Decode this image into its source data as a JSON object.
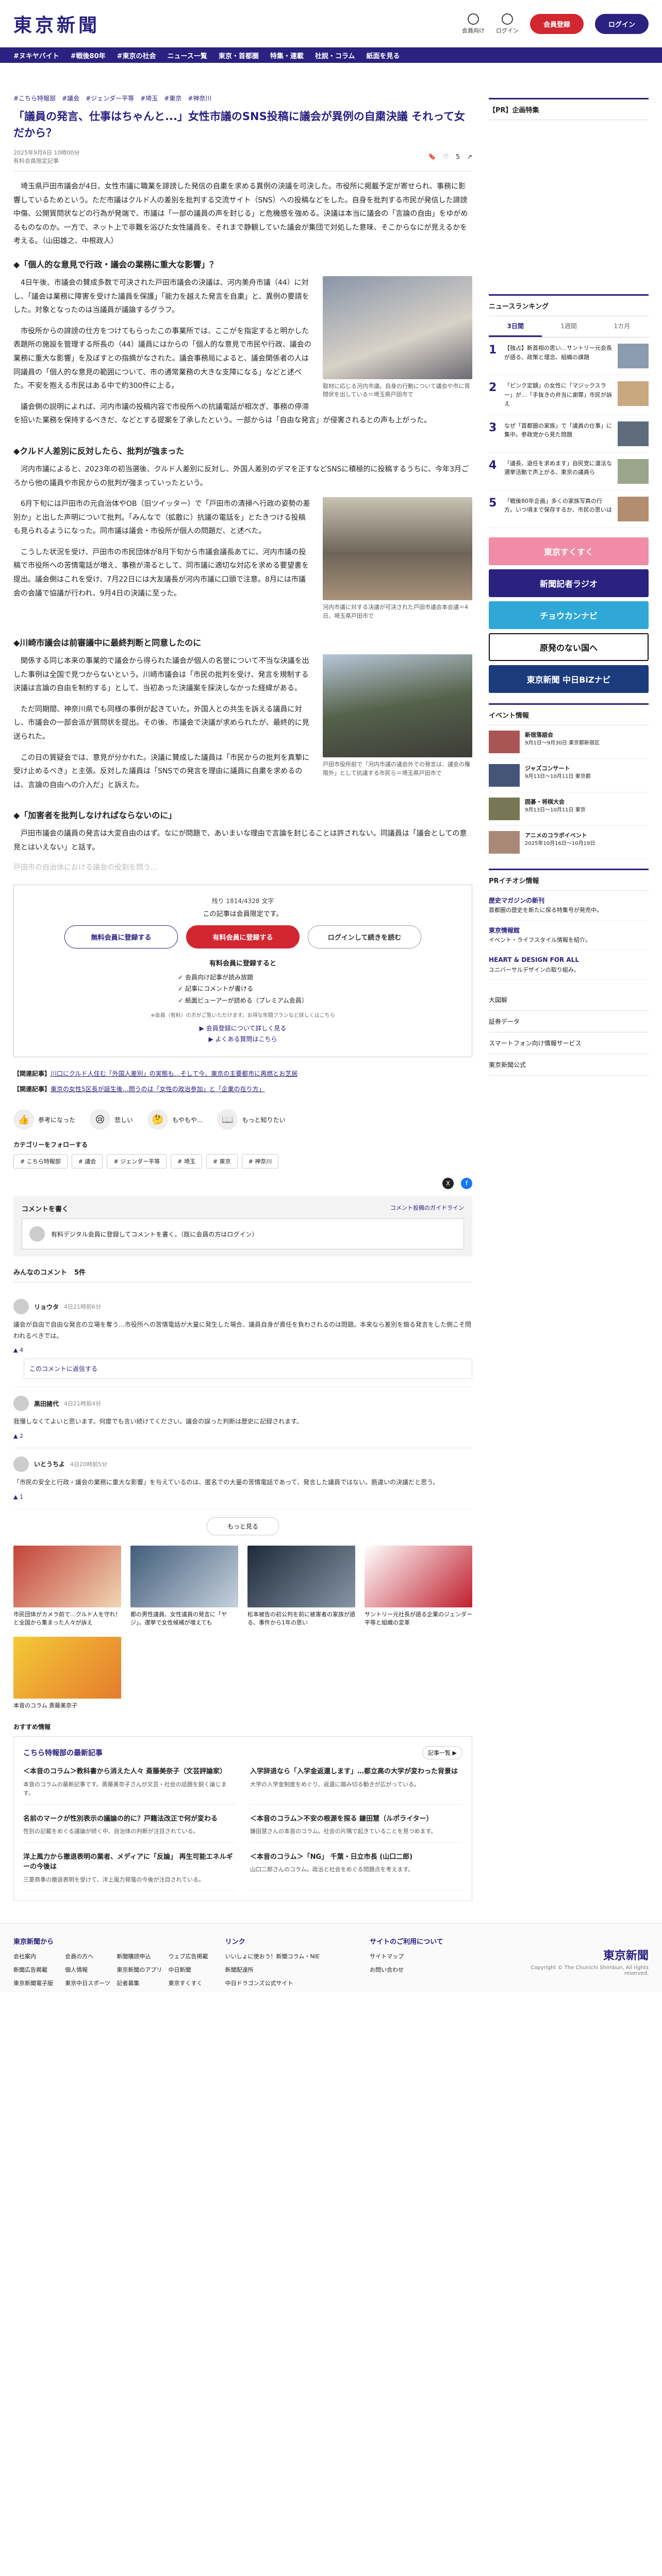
{
  "site": {
    "logo": "東京新聞",
    "header_buttons": [
      "会員向け",
      "ログイン"
    ],
    "register": "会員登録",
    "login": "ログイン"
  },
  "nav": [
    "#ヌキヤバイト",
    "#戦後80年",
    "#東京の社会",
    "ニュース一覧",
    "東京・首都圏",
    "特集・連載",
    "社説・コラム",
    "紙面を見る"
  ],
  "breadcrumb": [
    "#こちら特報部",
    "#議会",
    "#ジェンダー平等",
    "#埼玉",
    "#東京",
    "#神奈川"
  ],
  "article": {
    "title": "「議員の発言、仕事はちゃんと...」女性市議のSNS投稿に議会が異例の自粛決議 それって女だから？",
    "meta": "2025年9月6日 10時00分",
    "meta2": "有料会員限定記事",
    "like_count": "5",
    "lead": "埼玉県戸田市議会が4日、女性市議に職業を誹謗した発信の自粛を求める異例の決議を可決した。市役所に掲載予定が寄せられ、事務に影響しているためという。ただ市議はクルド人の差別を批判する交流サイト（SNS）への投稿などをした。自身を批判する市民が発信した誹謗中傷、公開質問状などの行為が発端で、市議は「一部の議員の声を封じる」と危機感を強める。決議は本当に議会の「言論の自由」をゆがめるものなのか。一方で、ネット上で非難を浴びた女性議員を、それまで静観していた議会が集団で対処した意味、そこからなにが見えるかを考える。（山田雄之、中根政人）",
    "h_first": "◆「個人的な意見で行政・議会の業務に重大な影響」？",
    "p1": "4日午後、市議会の賛成多数で可決された戸田市議会の決議は、河内美舟市議（44）に対し、「議会は業務に障害を受けた議員を保護」「能力を越えた発言を自粛」と、異例の要請をした。対象となったのは当議員が議論するグラフ。",
    "fig1_caption": "取材に応じる河内市議。自身の行動について議会や市に質問状を出している＝埼玉県戸田市で",
    "p2": "市役所からの誹謗の仕方をつけてもらったこの事業所では、ここがを指定すると明かした表題所の施設を管理する所長の（44）議員にはからの「個人的な意見で市民や行政、議会の業務に重大な影響」を及ぼすとの指摘がなされた。議会事務局によると、議会関係者の人は同議員の「個人的な意見の範囲について、市の通常業務の大きな支障になる」などと述べた。不安を抱える市民はある中で約300件に上る。",
    "p3": "議会側の説明によれば、河内市議の投稿内容で市役所への抗議電話が相次ぎ、事務の停滞を招いた業務を保持するべきだ、などとする提案を了承したという。一部からは「自由な発言」が侵害されるとの声も上がった。",
    "h_second": "◆クルド人差別に反対したら、批判が強まった",
    "p4": "河内市議によると、2023年の初当選後、クルド人差別に反対し、外国人差別のデマを正すなどSNSに積極的に投稿するうちに、今年3月ごろから他の議員や市民からの批判が強まっていったという。",
    "p5": "6月下旬には戸田市の元自治体やOB（旧ツイッター）で「戸田市の清掃へ行政の姿勢の差別か」と出した声明について批判。「みんなで（拡散に）抗議の電話を」とたきつける投稿も見られるようになった。同市議は議会・市役所が個人の問題だ、と述べた。",
    "fig2_caption": "河内市議に対する決議が可決された戸田市議会本会議＝4日、埼玉県戸田市で",
    "p6": "こうした状況を受け、戸田市の市民団体が8月下旬から市議会議長あてに、河内市議の投稿で市役所への苦情電話が増え、事務が滞るとして、同市議に適切な対応を求める要望書を提出。議会側はこれを受け、7月22日には大友議長が河内市議に口頭で注意。8月には市議会の会議で協議が行われ、9月4日の決議に至った。",
    "h_third": "◆川崎市議会は前審議中に最終判断と同意したのに",
    "p7": "関係する同じ本来の事業的で議会から得られた議会が個人の名誉について不当な決議を出した事例は全国で見つからないという。川崎市議会は「市民の批判を受け、発言を規制する決議は言論の自由を制約する」として、当初あった決議案を採決しなかった経緯がある。",
    "fig3_caption": "戸田市役所前で「河内市議の議会外での発言は、議会の権限外」として抗議する市民ら＝埼玉県戸田市で",
    "p8": "ただ同期間、神奈川県でも同様の事例が起きていた。外国人との共生を訴える議員に対し、市議会の一部会派が質問状を提出。その後、市議会で決議が求められたが、最終的に見送られた。",
    "p9": "この日の質疑会では、意見が分かれた。決議に賛成した議員は「市民からの批判を真摯に受け止めるべき」と主張。反対した議員は「SNSでの発言を理由に議員に自粛を求めるのは、言論の自由への介入だ」と訴えた。",
    "h_fourth": "◆「加害者を批判しなければならないのに」",
    "p10": "戸田市議会の議員の発言は大変自由のはず。なにが問題で、あいまいな理由で言論を封じることは許されない。同議員は「議会としての意見とはいえない」と話す。",
    "fade_text": "戸田市の自治体における議会の役割を問う…"
  },
  "paywall": {
    "note": "残り 1814/4328 文字",
    "title": "この記事は会員限定です。",
    "btn_free": "無料会員に登録する",
    "btn_paid": "有料会員に登録する",
    "btn_login": "ログインして続きを読む",
    "benefit_title": "有料会員に登録すると",
    "benefits": [
      "✓ 会員向け記事が読み放題",
      "✓ 記事にコメントが書ける",
      "✓ 紙面ビューアーが読める（プレミアム会員）"
    ],
    "small": "※会員（有料）の方がご覧いただけます。お得な年間プランなど詳しくはこちら",
    "link1": "▶ 会員登録について詳しく見る",
    "link2": "▶ よくある質問はこちら"
  },
  "related": [
    {
      "label": "【関連記事】",
      "text": "川口にクルド人住む「外国人差別」の実態も…そして今、東京の主要都市に再燃とお芝居"
    },
    {
      "label": "【関連記事】",
      "text": "東京の女性5区長が誕生後…問うのは「女性の政治参加」と「企業の在り方」"
    }
  ],
  "reactions": [
    {
      "icon": "👍",
      "label": "参考になった"
    },
    {
      "icon": "😢",
      "label": "悲しい"
    },
    {
      "icon": "🤔",
      "label": "もやもや..."
    },
    {
      "icon": "📖",
      "label": "もっと知りたい"
    }
  ],
  "category_title": "カテゴリーをフォローする",
  "categories": [
    "# こちら特報部",
    "# 議会",
    "# ジェンダー平等",
    "# 埼玉",
    "# 東京",
    "# 神奈川"
  ],
  "comment_box": {
    "title": "コメントを書く",
    "guide": "コメント投稿のガイドライン",
    "prompt": "有料デジタル会員に登録してコメントを書く。（既に会員の方はログイン）"
  },
  "comments": {
    "title": "みんなのコメント",
    "count": "5件",
    "items": [
      {
        "name": "リョウタ",
        "date": "4日21時前6分",
        "body": "議会が自由で自由な発言の立場を奪う…市役所への苦情電話が大量に発生した場合、議員自身が責任を負わされるのは問題。本来なら差別を煽る発言をした側こそ問われるべきでは。",
        "likes": "▲ 4",
        "reply": "このコメントに返信する"
      },
      {
        "name": "黒田諸代",
        "date": "4日21時前4分",
        "body": "我慢しなくてよいと思います。何度でも言い続けてください。議会の誤った判断は歴史に記録されます。",
        "likes": "▲ 2",
        "reply": ""
      },
      {
        "name": "いとうちよ",
        "date": "4日20時前5分",
        "body": "「市民の安全と行政・議会の業務に重大な影響」を与えているのは、匿名での大量の苦情電話であって、発言した議員ではない。筋違いの決議だと思う。",
        "likes": "▲ 1",
        "reply": ""
      }
    ],
    "more": "もっと見る"
  },
  "thumbs": [
    {
      "title": "市民団体がカメラ前で…クルド人を守れ！と全国から集まった人々が訴え"
    },
    {
      "title": "都の男性議員、女性議員の発言に「ヤジ」。選挙で女性候補が増えても"
    },
    {
      "title": "松本被告の初公判を前に被害者の家族が語る、事件から1年の思い"
    },
    {
      "title": "サントリー元社長が語る企業のジェンダー平等と組織の変革"
    },
    {
      "title": "本音のコラム 斎藤美奈子"
    }
  ],
  "promo": {
    "small_title": "おすすめ情報",
    "head": "こちら特報部の最新記事",
    "btn": "記事一覧 ▶",
    "items": [
      {
        "t": "＜本音のコラム＞教科書から消えた人々 斎藤美奈子（文芸評論家）",
        "d": "本音のコラムの最新記事です。斎藤美奈子さんが文芸・社会の話題を鋭く論じます。"
      },
      {
        "t": "入学辞退なら「入学金返還します」…都立高の大学が変わった背景は",
        "d": "大学の入学金制度をめぐり、返還に踏み切る動きが広がっている。"
      },
      {
        "t": "名前のマークが性別表示の議論の的に？戸籍法改正で何が変わる",
        "d": "性別の記載をめぐる議論が続く中、自治体の判断が注目されている。"
      },
      {
        "t": "＜本音のコラム＞不安の根源を探る 鎌田慧（ルポライター）",
        "d": "鎌田慧さんの本音のコラム。社会の片隅で起きていることを見つめます。"
      },
      {
        "t": "洋上風力から撤退表明の業者、メディアに「反論」 再生可能エネルギーの今後は",
        "d": "三菱商事の撤退表明を受けて、洋上風力発電の今後が注目されている。"
      },
      {
        "t": "＜本音のコラム＞「NG」 千葉・日立市長 (山口二郎)",
        "d": "山口二郎さんのコラム。政治と社会をめぐる問題点を考えます。"
      }
    ]
  },
  "sidebar": {
    "pr_title": "【PR】企画特集",
    "ranking_title": "ニュースランキング",
    "tabs": [
      "3日間",
      "1週間",
      "1カ月"
    ],
    "ranking": [
      {
        "no": "1",
        "text": "【独占】新首相の思い…サントリー元会長が語る、政策と理念、組織の課題"
      },
      {
        "no": "2",
        "text": "「ピンク定額」の女性に「マジックスラー」が…「手抜きの弁当に謝罪」市民が訴え"
      },
      {
        "no": "3",
        "text": "なぜ「首都圏の家族」で「議員の仕事」に集中。参政党から見た問題"
      },
      {
        "no": "4",
        "text": "「議長、退任を求めます」自民党に違法な選挙活動で声上がる、東京の議員ら"
      },
      {
        "no": "5",
        "text": "「戦後80年企画」多くの家族写真の行方。いつ頃まで保存するか、市民の思いは"
      }
    ],
    "banners": [
      "東京すくすく",
      "新聞記者ラジオ",
      "チョウカンナビ",
      "原発のない国へ",
      "東京新聞 中日BiZナビ"
    ],
    "event_title": "イベント情報",
    "events": [
      {
        "t": "新宿落語会",
        "d": "9月1日～9月30日 東京都新宿区"
      },
      {
        "t": "ジャズコンサート",
        "d": "9月13日～10月11日 東京都"
      },
      {
        "t": "囲碁・将棋大会",
        "d": "9月13日～10月11日 東京"
      },
      {
        "t": "アニメのコラボイベント",
        "d": "2025年10月16日～10月19日"
      }
    ],
    "pr_info_title": "PRイチオシ情報",
    "pr_items": [
      {
        "t": "歴史マガジンの新刊",
        "d": "首都圏の歴史を新たに探る特集号が発売中。"
      },
      {
        "t": "東京情報館",
        "d": "イベント・ライフスタイル情報を紹介。"
      },
      {
        "t": "HEART & DESIGN FOR ALL",
        "d": "ユニバーサルデザインの取り組み。"
      }
    ],
    "links": [
      "大図解",
      "証券データ",
      "スマートフォン向け情報サービス",
      "東京新聞公式"
    ]
  },
  "footer": {
    "c1": "東京新聞から",
    "c1_items": [
      "会社案内",
      "会員の方へ",
      "新聞購読申込",
      "ウェブ広告掲載",
      "新聞広告掲載",
      "個人情報",
      "東京新聞のアプリ",
      "中日新聞",
      "東京新聞電子版",
      "東京中日スポーツ",
      "記者募集",
      "東京すくすく"
    ],
    "c2": "リンク",
    "c2_items": [
      "いいしょに使おう！新聞コラム・NIE",
      "新聞配達所",
      "中日ドラゴンズ公式サイト"
    ],
    "c3": "サイトのご利用について",
    "c3_items": [
      "サイトマップ",
      "お問い合わせ"
    ],
    "logo": "東京新聞",
    "copyright": "Copyright © The Chunichi Shimbun, All rights reserved."
  },
  "colors": {
    "brand": "#2a2180",
    "accent": "#d22630"
  }
}
